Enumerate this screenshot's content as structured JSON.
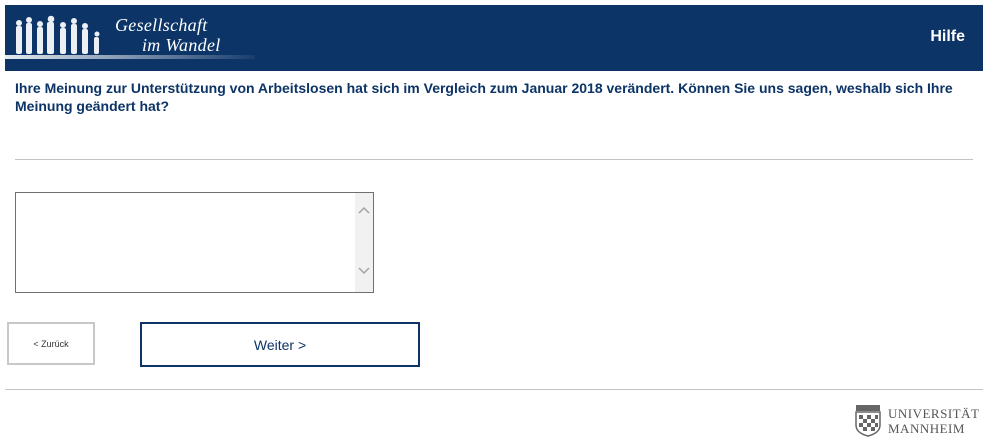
{
  "header": {
    "logo": {
      "line1": "Gesellschaft",
      "line2": "im Wandel"
    },
    "help_label": "Hilfe",
    "colors": {
      "background": "#0c3467",
      "text": "#ffffff"
    }
  },
  "question": {
    "text": "Ihre Meinung zur Unterstützung von Arbeitslosen hat sich im Vergleich zum Januar 2018 verändert. Können Sie uns sagen, weshalb sich Ihre Meinung geändert hat?"
  },
  "answer": {
    "value": "",
    "placeholder": ""
  },
  "navigation": {
    "back_label": "< Zurück",
    "next_label": "Weiter >"
  },
  "footer": {
    "logo": {
      "line1": "UNIVERSITÄT",
      "line2": "MANNHEIM"
    }
  },
  "icons": {
    "scroll_up": "chevron-up-icon",
    "scroll_down": "chevron-down-icon",
    "logo_figures": "people-silhouettes-icon",
    "seal": "university-seal-icon"
  }
}
